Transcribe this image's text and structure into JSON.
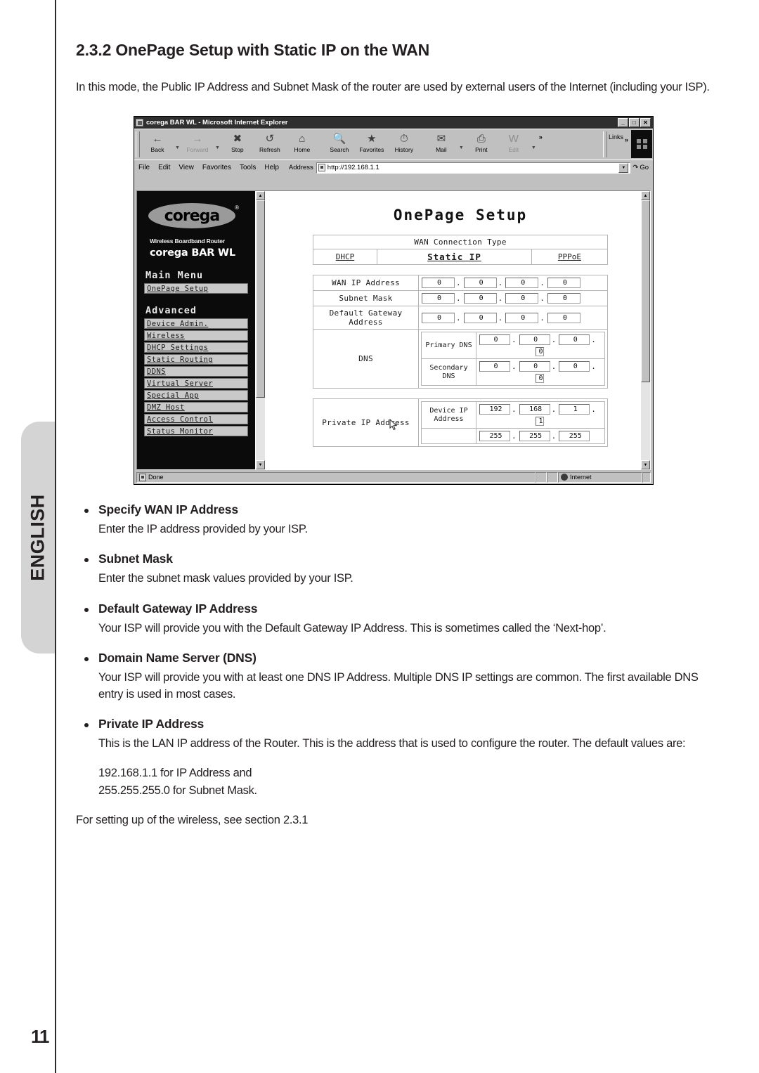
{
  "page": {
    "number": "11",
    "side_tab": "ENGLISH"
  },
  "section": {
    "heading": "2.3.2 OnePage Setup with Static IP  on the WAN",
    "intro": "In this mode, the Public IP Address and Subnet Mask of the router are used by external users of the Internet (including your ISP)."
  },
  "browser": {
    "title": "corega BAR WL - Microsoft Internet Explorer",
    "window_buttons": {
      "minimize": "_",
      "maximize": "□",
      "close": "✕"
    },
    "toolbar": [
      {
        "label": "Back",
        "icon": "back-arrow-icon",
        "dim": false,
        "dropdown": true
      },
      {
        "label": "Forward",
        "icon": "forward-arrow-icon",
        "dim": true,
        "dropdown": true
      },
      {
        "label": "Stop",
        "icon": "stop-icon",
        "dim": false,
        "dropdown": false
      },
      {
        "label": "Refresh",
        "icon": "refresh-icon",
        "dim": false,
        "dropdown": false
      },
      {
        "label": "Home",
        "icon": "home-icon",
        "dim": false,
        "dropdown": false
      },
      {
        "label": "Search",
        "icon": "search-icon",
        "dim": false,
        "dropdown": false
      },
      {
        "label": "Favorites",
        "icon": "favorites-star-icon",
        "dim": false,
        "dropdown": false
      },
      {
        "label": "History",
        "icon": "history-clock-icon",
        "dim": false,
        "dropdown": false
      },
      {
        "label": "Mail",
        "icon": "mail-icon",
        "dim": false,
        "dropdown": true
      },
      {
        "label": "Print",
        "icon": "printer-icon",
        "dim": false,
        "dropdown": false
      },
      {
        "label": "Edit",
        "icon": "edit-word-icon",
        "dim": true,
        "dropdown": true
      }
    ],
    "overflow_chevron": "»",
    "links_label": "Links",
    "links_chevron": "»",
    "menu": [
      "File",
      "Edit",
      "View",
      "Favorites",
      "Tools",
      "Help"
    ],
    "address_label": "Address",
    "address_value": "http://192.168.1.1",
    "go_label": "Go",
    "status": {
      "text": "Done",
      "zone": "Internet"
    }
  },
  "router_ui": {
    "brand": "corega",
    "brand_reg": "®",
    "tagline": "Wireless Boardband Router",
    "model": "corega  BAR WL",
    "main_menu_title": "Main Menu",
    "main_menu_items": [
      "OnePage Setup"
    ],
    "advanced_title": "Advanced",
    "advanced_items": [
      "Device Admin.",
      "Wireless",
      "DHCP Settings",
      "Static Routing",
      "DDNS",
      "Virtual Server",
      "Special App",
      "DMZ Host",
      "Access Control",
      "Status Monitor"
    ],
    "page_title": "OnePage Setup",
    "wan_section_header": "WAN Connection Type",
    "wan_tabs": [
      {
        "label": "DHCP",
        "selected": false
      },
      {
        "label": "Static IP",
        "selected": true
      },
      {
        "label": "PPPoE",
        "selected": false
      }
    ],
    "fields": [
      {
        "label": "WAN IP Address",
        "octets": [
          "0",
          "0",
          "0",
          "0"
        ]
      },
      {
        "label": "Subnet Mask",
        "octets": [
          "0",
          "0",
          "0",
          "0"
        ]
      },
      {
        "label": "Default Gateway Address",
        "octets": [
          "0",
          "0",
          "0",
          "0"
        ]
      }
    ],
    "dns": {
      "label": "DNS",
      "rows": [
        {
          "label": "Primary DNS",
          "octets": [
            "0",
            "0",
            "0",
            "0"
          ]
        },
        {
          "label": "Secondary DNS",
          "octets": [
            "0",
            "0",
            "0",
            "0"
          ]
        }
      ]
    },
    "private_ip": {
      "label": "Private IP Address",
      "rows": [
        {
          "label": "Device IP Address",
          "octets": [
            "192",
            "168",
            "1",
            "1"
          ]
        },
        {
          "label": "",
          "octets": [
            "255",
            "255",
            "255",
            ""
          ]
        }
      ]
    }
  },
  "bullets": [
    {
      "title": "Specify WAN IP Address",
      "body": "Enter the IP address provided by your ISP."
    },
    {
      "title": "Subnet Mask",
      "body": "Enter the subnet mask values provided by your ISP."
    },
    {
      "title": "Default Gateway IP Address",
      "body": "Your ISP will provide you with the Default Gateway IP Address. This is sometimes called the ‘Next-hop’."
    },
    {
      "title": "Domain Name Server (DNS)",
      "body": "Your ISP will provide you with at least one DNS IP Address. Multiple DNS IP settings are common. The first available DNS entry is used in most cases."
    },
    {
      "title": "Private IP Address",
      "body": "This is the LAN IP address of the Router. This is the address that is used to configure the router. The default values are:"
    }
  ],
  "defaults": {
    "line1": "192.168.1.1 for IP Address and",
    "line2": "255.255.255.0 for Subnet Mask."
  },
  "footnote": "For setting up of the wireless, see section 2.3.1"
}
